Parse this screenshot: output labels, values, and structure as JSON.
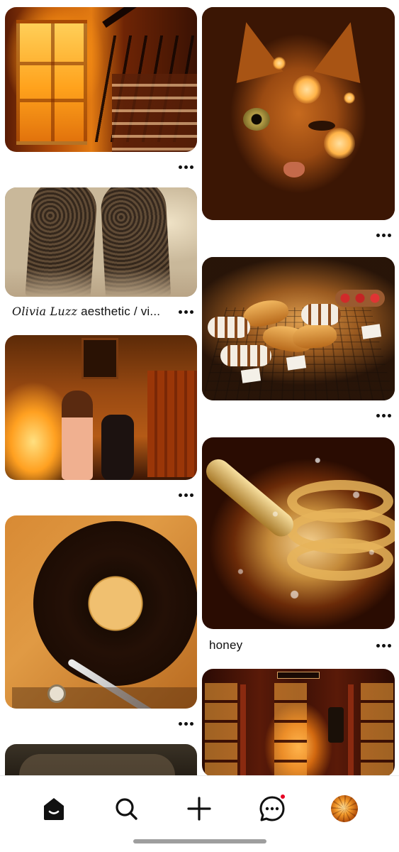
{
  "feed": {
    "left": [
      {
        "image": "sunlit window staircase",
        "title": "",
        "more_label": "More options"
      },
      {
        "image": "lace tights",
        "title_script": "Olivia Luzz",
        "title": "aesthetic / vi...",
        "more_label": "More options"
      },
      {
        "image": "painter girl in warm room",
        "title": "",
        "more_label": "More options"
      },
      {
        "image": "vinyl record player",
        "title": "",
        "more_label": "More options"
      },
      {
        "image": "dark partial image",
        "title": ""
      }
    ],
    "right": [
      {
        "image": "cat with flower light",
        "title": "",
        "more_label": "More options"
      },
      {
        "image": "bakery pastries",
        "title": "",
        "more_label": "More options"
      },
      {
        "image": "honey dipper",
        "title": "honey",
        "more_label": "More options"
      },
      {
        "image": "red telephone booth",
        "title": ""
      }
    ]
  },
  "nav": {
    "items": [
      {
        "name": "home",
        "icon": "home-icon",
        "active": true
      },
      {
        "name": "search",
        "icon": "search-icon"
      },
      {
        "name": "create",
        "icon": "plus-icon"
      },
      {
        "name": "messages",
        "icon": "chat-icon",
        "notification": true
      },
      {
        "name": "profile",
        "icon": "avatar"
      }
    ]
  },
  "colors": {
    "notification": "#e60023",
    "text": "#111111",
    "background": "#ffffff"
  }
}
